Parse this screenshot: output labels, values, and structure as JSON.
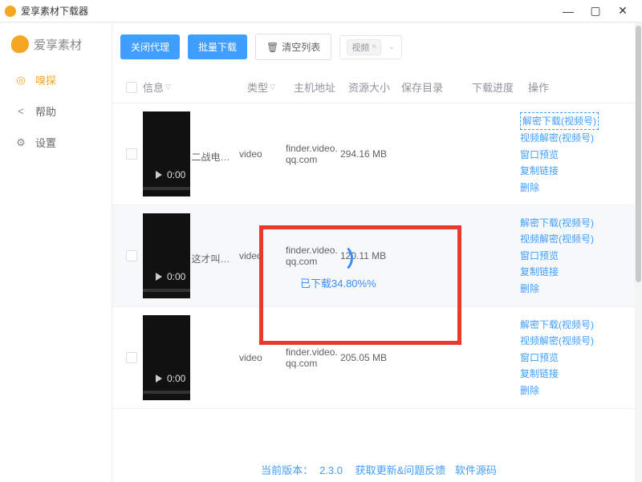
{
  "window": {
    "title": "爱享素材下载器"
  },
  "brand": "爱享素材",
  "nav": {
    "sniff": "嗅探",
    "help": "帮助",
    "settings": "设置"
  },
  "toolbar": {
    "close_proxy": "关闭代理",
    "batch_download": "批量下载",
    "clear_list": "清空列表",
    "filter_tag": "视频"
  },
  "columns": {
    "info": "信息",
    "type": "类型",
    "host": "主机地址",
    "size": "资源大小",
    "dir": "保存目录",
    "progress": "下载进度",
    "ops": "操作"
  },
  "rows": [
    {
      "caption": "二战电影《逃兵行动》",
      "type": "video",
      "host": "finder.video.qq.com",
      "size": "294.16 MB",
      "time": "0:00"
    },
    {
      "caption": "这才叫空战大片，精彩",
      "type": "video",
      "host": "finder.video.qq.com",
      "size": "120.11 MB",
      "time": "0:00"
    },
    {
      "caption": "",
      "type": "video",
      "host": "finder.video.qq.com",
      "size": "205.05 MB",
      "time": "0:00"
    }
  ],
  "progress_overlay": "已下载34.80%%",
  "ops": {
    "decrypt_dl": "解密下载(视频号)",
    "video_decrypt": "视频解密(视频号)",
    "window_preview": "窗口预览",
    "copy_link": "复制链接",
    "delete": "删除"
  },
  "footer": {
    "version_label": "当前版本：",
    "version": "2.3.0",
    "update": "获取更新&问题反馈",
    "source": "软件源码"
  }
}
